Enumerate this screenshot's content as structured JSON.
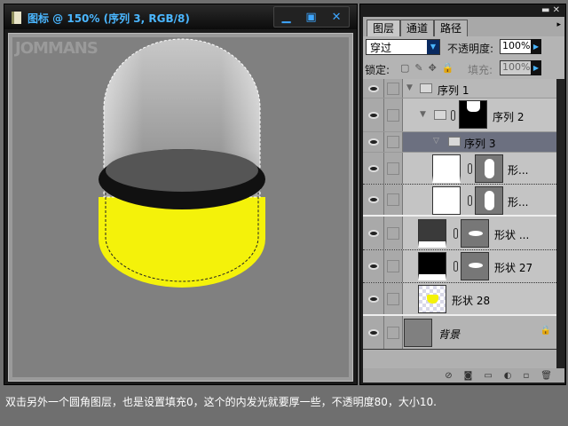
{
  "document": {
    "title": "图标 @ 150% (序列 3, RGB/8)",
    "watermark": "JOMMANS",
    "buttons": {
      "minimize": "▁",
      "restore": "▣",
      "close": "✕"
    }
  },
  "layers_panel": {
    "tabs": [
      "图层",
      "通道",
      "路径"
    ],
    "blend_mode": "穿过",
    "opacity_label": "不透明度:",
    "opacity": "100%",
    "lock_label": "锁定:",
    "fill_label": "填充:",
    "fill": "100%",
    "layers": [
      {
        "name": "序列 1"
      },
      {
        "name": "序列 2"
      },
      {
        "name": "序列 3"
      },
      {
        "name": "形..."
      },
      {
        "name": "形..."
      },
      {
        "name": "形状 ..."
      },
      {
        "name": "形状 27"
      },
      {
        "name": "形状 28"
      },
      {
        "name": "背景"
      }
    ]
  },
  "caption": "双击另外一个圆角图层，也是设置填充0，这个的内发光就要厚一些，不透明度80，大小10."
}
